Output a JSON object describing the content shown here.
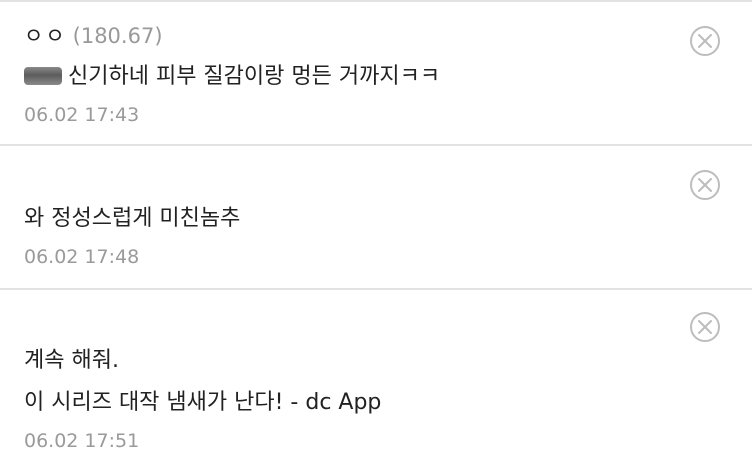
{
  "comments": [
    {
      "author": "ㅇㅇ",
      "ip": "(180.67)",
      "lines": [
        "신기하네 피부 질감이랑 멍든 거까지ㅋㅋ"
      ],
      "time": "06.02 17:43",
      "delete_icon": "close-circle-icon"
    },
    {
      "lines": [
        "와 정성스럽게 미친놈추"
      ],
      "time": "06.02 17:48",
      "delete_icon": "close-circle-icon"
    },
    {
      "lines": [
        "계속 해줘.",
        "이 시리즈 대작 냄새가 난다! - dc App"
      ],
      "time": "06.02 17:51",
      "delete_icon": "close-circle-icon"
    }
  ],
  "colors": {
    "text": "#222222",
    "muted": "#999999",
    "divider": "#e2e2e2",
    "icon": "#bdbdbd"
  }
}
